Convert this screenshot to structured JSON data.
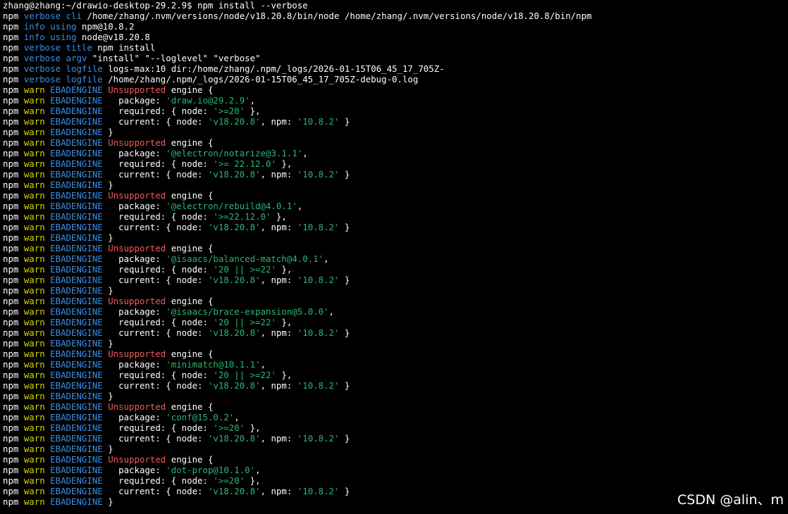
{
  "colors": {
    "white": "#ffffff",
    "blue": "#3a8ee6",
    "yellow": "#d7d700",
    "red": "#ef5b5b",
    "green": "#2bb673",
    "background": "#000000"
  },
  "watermark": "CSDN @alin、m",
  "lines": [
    [
      [
        "white",
        "zhang@zhang:~/drawio-desktop-29.2.9$ npm install --verbose"
      ]
    ],
    [
      [
        "white",
        "npm "
      ],
      [
        "blue",
        "verbose cli"
      ],
      [
        "white",
        " /home/zhang/.nvm/versions/node/v18.20.8/bin/node /home/zhang/.nvm/versions/node/v18.20.8/bin/npm"
      ]
    ],
    [
      [
        "white",
        "npm "
      ],
      [
        "blue",
        "info using"
      ],
      [
        "white",
        " npm@10.8.2"
      ]
    ],
    [
      [
        "white",
        "npm "
      ],
      [
        "blue",
        "info using"
      ],
      [
        "white",
        " node@v18.20.8"
      ]
    ],
    [
      [
        "white",
        "npm "
      ],
      [
        "blue",
        "verbose title"
      ],
      [
        "white",
        " npm install"
      ]
    ],
    [
      [
        "white",
        "npm "
      ],
      [
        "blue",
        "verbose argv"
      ],
      [
        "white",
        " \"install\" \"--loglevel\" \"verbose\""
      ]
    ],
    [
      [
        "white",
        "npm "
      ],
      [
        "blue",
        "verbose logfile"
      ],
      [
        "white",
        " logs-max:10 dir:/home/zhang/.npm/_logs/2026-01-15T06_45_17_705Z-"
      ]
    ],
    [
      [
        "white",
        "npm "
      ],
      [
        "blue",
        "verbose logfile"
      ],
      [
        "white",
        " /home/zhang/.npm/_logs/2026-01-15T06_45_17_705Z-debug-0.log"
      ]
    ],
    [
      [
        "white",
        "npm "
      ],
      [
        "yellow",
        "warn"
      ],
      [
        "blue",
        " EBADENGINE"
      ],
      [
        "red",
        " Unsupported"
      ],
      [
        "white",
        " engine {"
      ]
    ],
    [
      [
        "white",
        "npm "
      ],
      [
        "yellow",
        "warn"
      ],
      [
        "blue",
        " EBADENGINE"
      ],
      [
        "white",
        "   package: "
      ],
      [
        "green",
        "'draw.io@29.2.9'"
      ],
      [
        "white",
        ","
      ]
    ],
    [
      [
        "white",
        "npm "
      ],
      [
        "yellow",
        "warn"
      ],
      [
        "blue",
        " EBADENGINE"
      ],
      [
        "white",
        "   required: { node: "
      ],
      [
        "green",
        "'>=20'"
      ],
      [
        "white",
        " },"
      ]
    ],
    [
      [
        "white",
        "npm "
      ],
      [
        "yellow",
        "warn"
      ],
      [
        "blue",
        " EBADENGINE"
      ],
      [
        "white",
        "   current: { node: "
      ],
      [
        "green",
        "'v18.20.8'"
      ],
      [
        "white",
        ", npm: "
      ],
      [
        "green",
        "'10.8.2'"
      ],
      [
        "white",
        " }"
      ]
    ],
    [
      [
        "white",
        "npm "
      ],
      [
        "yellow",
        "warn"
      ],
      [
        "blue",
        " EBADENGINE"
      ],
      [
        "white",
        " }"
      ]
    ],
    [
      [
        "white",
        "npm "
      ],
      [
        "yellow",
        "warn"
      ],
      [
        "blue",
        " EBADENGINE"
      ],
      [
        "red",
        " Unsupported"
      ],
      [
        "white",
        " engine {"
      ]
    ],
    [
      [
        "white",
        "npm "
      ],
      [
        "yellow",
        "warn"
      ],
      [
        "blue",
        " EBADENGINE"
      ],
      [
        "white",
        "   package: "
      ],
      [
        "green",
        "'@electron/notarize@3.1.1'"
      ],
      [
        "white",
        ","
      ]
    ],
    [
      [
        "white",
        "npm "
      ],
      [
        "yellow",
        "warn"
      ],
      [
        "blue",
        " EBADENGINE"
      ],
      [
        "white",
        "   required: { node: "
      ],
      [
        "green",
        "'>= 22.12.0'"
      ],
      [
        "white",
        " },"
      ]
    ],
    [
      [
        "white",
        "npm "
      ],
      [
        "yellow",
        "warn"
      ],
      [
        "blue",
        " EBADENGINE"
      ],
      [
        "white",
        "   current: { node: "
      ],
      [
        "green",
        "'v18.20.8'"
      ],
      [
        "white",
        ", npm: "
      ],
      [
        "green",
        "'10.8.2'"
      ],
      [
        "white",
        " }"
      ]
    ],
    [
      [
        "white",
        "npm "
      ],
      [
        "yellow",
        "warn"
      ],
      [
        "blue",
        " EBADENGINE"
      ],
      [
        "white",
        " }"
      ]
    ],
    [
      [
        "white",
        "npm "
      ],
      [
        "yellow",
        "warn"
      ],
      [
        "blue",
        " EBADENGINE"
      ],
      [
        "red",
        " Unsupported"
      ],
      [
        "white",
        " engine {"
      ]
    ],
    [
      [
        "white",
        "npm "
      ],
      [
        "yellow",
        "warn"
      ],
      [
        "blue",
        " EBADENGINE"
      ],
      [
        "white",
        "   package: "
      ],
      [
        "green",
        "'@electron/rebuild@4.0.1'"
      ],
      [
        "white",
        ","
      ]
    ],
    [
      [
        "white",
        "npm "
      ],
      [
        "yellow",
        "warn"
      ],
      [
        "blue",
        " EBADENGINE"
      ],
      [
        "white",
        "   required: { node: "
      ],
      [
        "green",
        "'>=22.12.0'"
      ],
      [
        "white",
        " },"
      ]
    ],
    [
      [
        "white",
        "npm "
      ],
      [
        "yellow",
        "warn"
      ],
      [
        "blue",
        " EBADENGINE"
      ],
      [
        "white",
        "   current: { node: "
      ],
      [
        "green",
        "'v18.20.8'"
      ],
      [
        "white",
        ", npm: "
      ],
      [
        "green",
        "'10.8.2'"
      ],
      [
        "white",
        " }"
      ]
    ],
    [
      [
        "white",
        "npm "
      ],
      [
        "yellow",
        "warn"
      ],
      [
        "blue",
        " EBADENGINE"
      ],
      [
        "white",
        " }"
      ]
    ],
    [
      [
        "white",
        "npm "
      ],
      [
        "yellow",
        "warn"
      ],
      [
        "blue",
        " EBADENGINE"
      ],
      [
        "red",
        " Unsupported"
      ],
      [
        "white",
        " engine {"
      ]
    ],
    [
      [
        "white",
        "npm "
      ],
      [
        "yellow",
        "warn"
      ],
      [
        "blue",
        " EBADENGINE"
      ],
      [
        "white",
        "   package: "
      ],
      [
        "green",
        "'@isaacs/balanced-match@4.0.1'"
      ],
      [
        "white",
        ","
      ]
    ],
    [
      [
        "white",
        "npm "
      ],
      [
        "yellow",
        "warn"
      ],
      [
        "blue",
        " EBADENGINE"
      ],
      [
        "white",
        "   required: { node: "
      ],
      [
        "green",
        "'20 || >=22'"
      ],
      [
        "white",
        " },"
      ]
    ],
    [
      [
        "white",
        "npm "
      ],
      [
        "yellow",
        "warn"
      ],
      [
        "blue",
        " EBADENGINE"
      ],
      [
        "white",
        "   current: { node: "
      ],
      [
        "green",
        "'v18.20.8'"
      ],
      [
        "white",
        ", npm: "
      ],
      [
        "green",
        "'10.8.2'"
      ],
      [
        "white",
        " }"
      ]
    ],
    [
      [
        "white",
        "npm "
      ],
      [
        "yellow",
        "warn"
      ],
      [
        "blue",
        " EBADENGINE"
      ],
      [
        "white",
        " }"
      ]
    ],
    [
      [
        "white",
        "npm "
      ],
      [
        "yellow",
        "warn"
      ],
      [
        "blue",
        " EBADENGINE"
      ],
      [
        "red",
        " Unsupported"
      ],
      [
        "white",
        " engine {"
      ]
    ],
    [
      [
        "white",
        "npm "
      ],
      [
        "yellow",
        "warn"
      ],
      [
        "blue",
        " EBADENGINE"
      ],
      [
        "white",
        "   package: "
      ],
      [
        "green",
        "'@isaacs/brace-expansion@5.0.0'"
      ],
      [
        "white",
        ","
      ]
    ],
    [
      [
        "white",
        "npm "
      ],
      [
        "yellow",
        "warn"
      ],
      [
        "blue",
        " EBADENGINE"
      ],
      [
        "white",
        "   required: { node: "
      ],
      [
        "green",
        "'20 || >=22'"
      ],
      [
        "white",
        " },"
      ]
    ],
    [
      [
        "white",
        "npm "
      ],
      [
        "yellow",
        "warn"
      ],
      [
        "blue",
        " EBADENGINE"
      ],
      [
        "white",
        "   current: { node: "
      ],
      [
        "green",
        "'v18.20.8'"
      ],
      [
        "white",
        ", npm: "
      ],
      [
        "green",
        "'10.8.2'"
      ],
      [
        "white",
        " }"
      ]
    ],
    [
      [
        "white",
        "npm "
      ],
      [
        "yellow",
        "warn"
      ],
      [
        "blue",
        " EBADENGINE"
      ],
      [
        "white",
        " }"
      ]
    ],
    [
      [
        "white",
        "npm "
      ],
      [
        "yellow",
        "warn"
      ],
      [
        "blue",
        " EBADENGINE"
      ],
      [
        "red",
        " Unsupported"
      ],
      [
        "white",
        " engine {"
      ]
    ],
    [
      [
        "white",
        "npm "
      ],
      [
        "yellow",
        "warn"
      ],
      [
        "blue",
        " EBADENGINE"
      ],
      [
        "white",
        "   package: "
      ],
      [
        "green",
        "'minimatch@10.1.1'"
      ],
      [
        "white",
        ","
      ]
    ],
    [
      [
        "white",
        "npm "
      ],
      [
        "yellow",
        "warn"
      ],
      [
        "blue",
        " EBADENGINE"
      ],
      [
        "white",
        "   required: { node: "
      ],
      [
        "green",
        "'20 || >=22'"
      ],
      [
        "white",
        " },"
      ]
    ],
    [
      [
        "white",
        "npm "
      ],
      [
        "yellow",
        "warn"
      ],
      [
        "blue",
        " EBADENGINE"
      ],
      [
        "white",
        "   current: { node: "
      ],
      [
        "green",
        "'v18.20.8'"
      ],
      [
        "white",
        ", npm: "
      ],
      [
        "green",
        "'10.8.2'"
      ],
      [
        "white",
        " }"
      ]
    ],
    [
      [
        "white",
        "npm "
      ],
      [
        "yellow",
        "warn"
      ],
      [
        "blue",
        " EBADENGINE"
      ],
      [
        "white",
        " }"
      ]
    ],
    [
      [
        "white",
        "npm "
      ],
      [
        "yellow",
        "warn"
      ],
      [
        "blue",
        " EBADENGINE"
      ],
      [
        "red",
        " Unsupported"
      ],
      [
        "white",
        " engine {"
      ]
    ],
    [
      [
        "white",
        "npm "
      ],
      [
        "yellow",
        "warn"
      ],
      [
        "blue",
        " EBADENGINE"
      ],
      [
        "white",
        "   package: "
      ],
      [
        "green",
        "'conf@15.0.2'"
      ],
      [
        "white",
        ","
      ]
    ],
    [
      [
        "white",
        "npm "
      ],
      [
        "yellow",
        "warn"
      ],
      [
        "blue",
        " EBADENGINE"
      ],
      [
        "white",
        "   required: { node: "
      ],
      [
        "green",
        "'>=20'"
      ],
      [
        "white",
        " },"
      ]
    ],
    [
      [
        "white",
        "npm "
      ],
      [
        "yellow",
        "warn"
      ],
      [
        "blue",
        " EBADENGINE"
      ],
      [
        "white",
        "   current: { node: "
      ],
      [
        "green",
        "'v18.20.8'"
      ],
      [
        "white",
        ", npm: "
      ],
      [
        "green",
        "'10.8.2'"
      ],
      [
        "white",
        " }"
      ]
    ],
    [
      [
        "white",
        "npm "
      ],
      [
        "yellow",
        "warn"
      ],
      [
        "blue",
        " EBADENGINE"
      ],
      [
        "white",
        " }"
      ]
    ],
    [
      [
        "white",
        "npm "
      ],
      [
        "yellow",
        "warn"
      ],
      [
        "blue",
        " EBADENGINE"
      ],
      [
        "red",
        " Unsupported"
      ],
      [
        "white",
        " engine {"
      ]
    ],
    [
      [
        "white",
        "npm "
      ],
      [
        "yellow",
        "warn"
      ],
      [
        "blue",
        " EBADENGINE"
      ],
      [
        "white",
        "   package: "
      ],
      [
        "green",
        "'dot-prop@10.1.0'"
      ],
      [
        "white",
        ","
      ]
    ],
    [
      [
        "white",
        "npm "
      ],
      [
        "yellow",
        "warn"
      ],
      [
        "blue",
        " EBADENGINE"
      ],
      [
        "white",
        "   required: { node: "
      ],
      [
        "green",
        "'>=20'"
      ],
      [
        "white",
        " },"
      ]
    ],
    [
      [
        "white",
        "npm "
      ],
      [
        "yellow",
        "warn"
      ],
      [
        "blue",
        " EBADENGINE"
      ],
      [
        "white",
        "   current: { node: "
      ],
      [
        "green",
        "'v18.20.8'"
      ],
      [
        "white",
        ", npm: "
      ],
      [
        "green",
        "'10.8.2'"
      ],
      [
        "white",
        " }"
      ]
    ],
    [
      [
        "white",
        "npm "
      ],
      [
        "yellow",
        "warn"
      ],
      [
        "blue",
        " EBADENGINE"
      ],
      [
        "white",
        " }"
      ]
    ]
  ]
}
